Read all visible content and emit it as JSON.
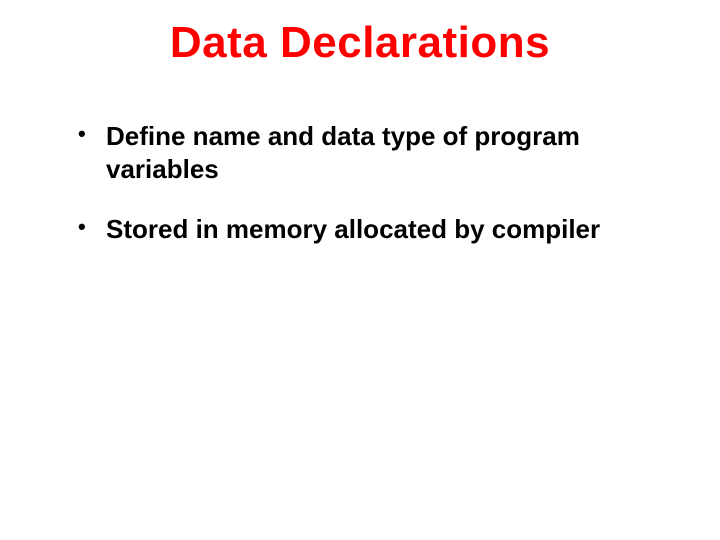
{
  "slide": {
    "title": "Data Declarations",
    "bullets": [
      "Define name and data type of program variables",
      "Stored in memory allocated by compiler"
    ]
  }
}
